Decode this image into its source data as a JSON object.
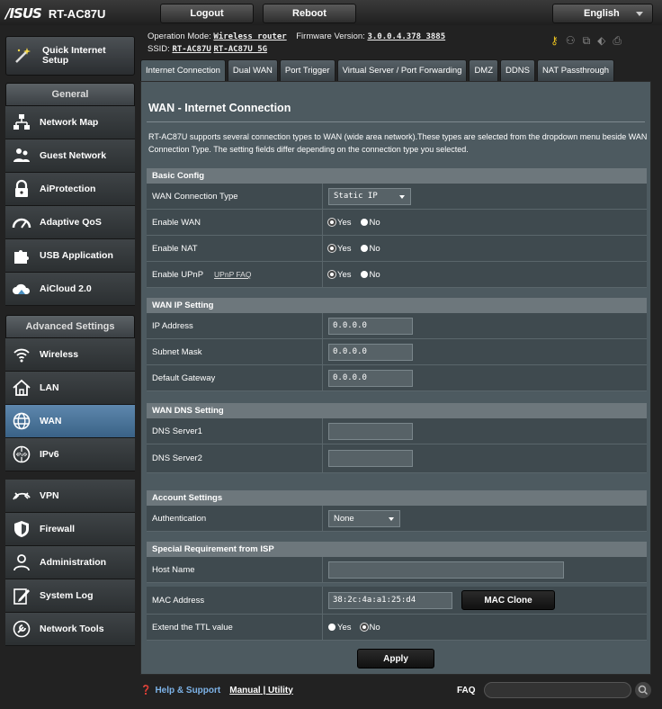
{
  "brand": {
    "logo": "/ISUS",
    "model": "RT-AC87U"
  },
  "topbar": {
    "logout": "Logout",
    "reboot": "Reboot",
    "language": "English"
  },
  "quick_setup": {
    "label": "Quick Internet Setup"
  },
  "menu": {
    "general_header": "General",
    "general_items": [
      {
        "label": "Network Map",
        "icon": "network-map-icon"
      },
      {
        "label": "Guest Network",
        "icon": "guest-network-icon"
      },
      {
        "label": "AiProtection",
        "icon": "lock-icon"
      },
      {
        "label": "Adaptive QoS",
        "icon": "gauge-icon"
      },
      {
        "label": "USB Application",
        "icon": "puzzle-icon"
      },
      {
        "label": "AiCloud 2.0",
        "icon": "cloud-icon"
      }
    ],
    "advanced_header": "Advanced Settings",
    "advanced_items": [
      {
        "label": "Wireless",
        "icon": "wifi-icon"
      },
      {
        "label": "LAN",
        "icon": "home-icon"
      },
      {
        "label": "WAN",
        "icon": "globe-icon",
        "active": true
      },
      {
        "label": "IPv6",
        "icon": "ipv6-icon"
      },
      {
        "label": "VPN",
        "icon": "vpn-icon"
      },
      {
        "label": "Firewall",
        "icon": "shield-icon"
      },
      {
        "label": "Administration",
        "icon": "user-icon"
      },
      {
        "label": "System Log",
        "icon": "log-icon"
      },
      {
        "label": "Network Tools",
        "icon": "tools-icon"
      }
    ]
  },
  "opinfo": {
    "mode_label": "Operation Mode:",
    "mode_value": "Wireless router",
    "fw_label": "Firmware Version:",
    "fw_value": "3.0.0.4.378_3885",
    "ssid_label": "SSID:",
    "ssid_1": "RT-AC87U",
    "ssid_2": "RT-AC87U_5G"
  },
  "tabs": [
    "Internet Connection",
    "Dual WAN",
    "Port Trigger",
    "Virtual Server / Port Forwarding",
    "DMZ",
    "DDNS",
    "NAT Passthrough"
  ],
  "page": {
    "title": "WAN - Internet Connection",
    "description": "RT-AC87U supports several connection types to WAN (wide area network).These types are selected from the dropdown menu beside WAN Connection Type. The setting fields differ depending on the connection type you selected."
  },
  "basic": {
    "header": "Basic Config",
    "conn_type_label": "WAN Connection Type",
    "conn_type_value": "Static IP",
    "enable_wan_label": "Enable WAN",
    "enable_nat_label": "Enable NAT",
    "enable_upnp_label": "Enable UPnP",
    "upnp_faq": "UPnP  FAQ",
    "yes": "Yes",
    "no": "No"
  },
  "ip": {
    "header": "WAN IP Setting",
    "ip_label": "IP Address",
    "ip_value": "0.0.0.0",
    "mask_label": "Subnet Mask",
    "mask_value": "0.0.0.0",
    "gw_label": "Default Gateway",
    "gw_value": "0.0.0.0"
  },
  "dns": {
    "header": "WAN DNS Setting",
    "dns1_label": "DNS Server1",
    "dns1_value": "",
    "dns2_label": "DNS Server2",
    "dns2_value": ""
  },
  "account": {
    "header": "Account Settings",
    "auth_label": "Authentication",
    "auth_value": "None"
  },
  "isp": {
    "header": "Special Requirement from ISP",
    "host_label": "Host Name",
    "host_value": "",
    "mac_label": "MAC Address",
    "mac_value": "38:2c:4a:a1:25:d4",
    "mac_clone": "MAC Clone",
    "ttl_label": "Extend the TTL value",
    "yes": "Yes",
    "no": "No"
  },
  "apply": "Apply",
  "footer": {
    "help": "Help & Support",
    "manual": "Manual",
    "sep": " | ",
    "utility": "Utility",
    "faq": "FAQ"
  }
}
